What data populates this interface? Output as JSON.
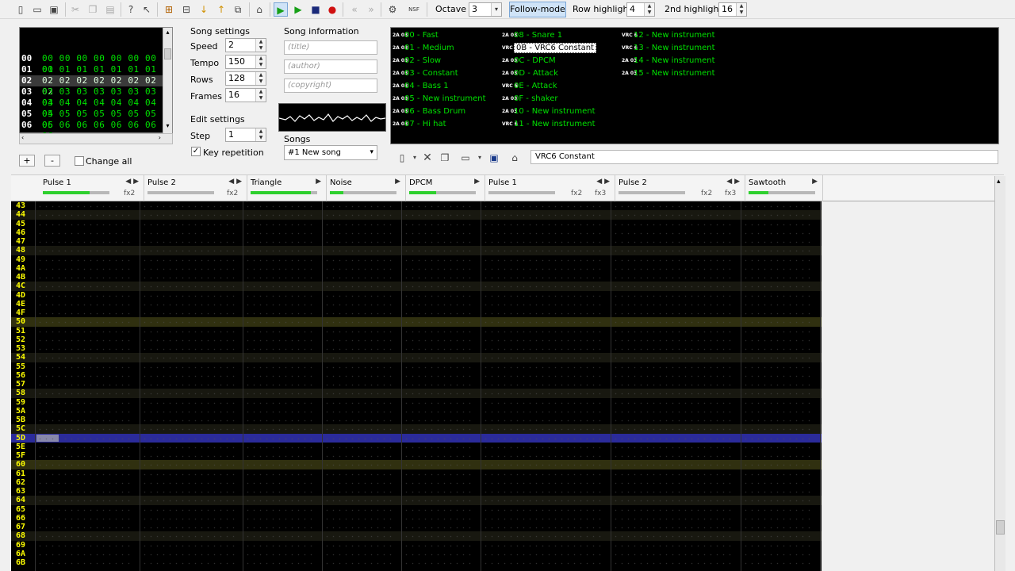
{
  "toolbar": {
    "octave_label": "Octave",
    "octave_value": "3",
    "follow_label": "Follow-mode",
    "row_highlight_label": "Row highlight",
    "row_highlight_value": "4",
    "second_highlight_label": "2nd highlight",
    "second_highlight_value": "16",
    "nsf_label": "NSF"
  },
  "frames": {
    "rows": [
      {
        "n": "00",
        "d": "00 00 00 00 00 00 00 00"
      },
      {
        "n": "01",
        "d": "01 01 01 01 01 01 01 01"
      },
      {
        "n": "02",
        "d": "02 02 02 02 02 02 02 02"
      },
      {
        "n": "03",
        "d": "03 03 03 03 03 03 03 03"
      },
      {
        "n": "04",
        "d": "04 04 04 04 04 04 04 04"
      },
      {
        "n": "05",
        "d": "05 05 05 05 05 05 05 05"
      },
      {
        "n": "06",
        "d": "06 06 06 06 06 06 06 06"
      }
    ],
    "add_label": "+",
    "remove_label": "-",
    "change_all_label": "Change all"
  },
  "song_settings": {
    "title": "Song settings",
    "speed_label": "Speed",
    "speed": "2",
    "tempo_label": "Tempo",
    "tempo": "150",
    "rows_label": "Rows",
    "rows": "128",
    "frames_label": "Frames",
    "frames": "16"
  },
  "edit_settings": {
    "title": "Edit settings",
    "step_label": "Step",
    "step": "1",
    "key_repetition_label": "Key repetition"
  },
  "song_info": {
    "title": "Song information",
    "title_placeholder": "(title)",
    "author_placeholder": "(author)",
    "copyright_placeholder": "(copyright)"
  },
  "songs": {
    "label": "Songs",
    "selected": "#1 New song"
  },
  "instruments": [
    {
      "icon": "2A 03",
      "name": "00 - Fast"
    },
    {
      "icon": "2A 03",
      "name": "01 - Medium"
    },
    {
      "icon": "2A 03",
      "name": "02 - Slow"
    },
    {
      "icon": "2A 03",
      "name": "03 - Constant"
    },
    {
      "icon": "2A 03",
      "name": "04 - Bass 1"
    },
    {
      "icon": "2A 03",
      "name": "05 - New instrument"
    },
    {
      "icon": "2A 03",
      "name": "06 - Bass Drum"
    },
    {
      "icon": "2A 03",
      "name": "07 - Hi hat"
    },
    {
      "icon": "2A 03",
      "name": "08 - Snare 1"
    },
    {
      "icon": "VRC 6",
      "name": "0B - VRC6 Constant"
    },
    {
      "icon": "2A 03",
      "name": "0C - DPCM"
    },
    {
      "icon": "2A 03",
      "name": "0D - Attack"
    },
    {
      "icon": "VRC 6",
      "name": "0E - Attack"
    },
    {
      "icon": "2A 03",
      "name": "0F - shaker"
    },
    {
      "icon": "2A 03",
      "name": "10 - New instrument"
    },
    {
      "icon": "VRC 6",
      "name": "11 - New instrument"
    },
    {
      "icon": "VRC 6",
      "name": "12 - New instrument"
    },
    {
      "icon": "VRC 6",
      "name": "13 - New instrument"
    },
    {
      "icon": "2A 03",
      "name": "14 - New instrument"
    },
    {
      "icon": "2A 03",
      "name": "15 - New instrument"
    }
  ],
  "instrument_name": "VRC6 Constant",
  "channels": [
    {
      "name": "Pulse 1",
      "fx": [
        "fx2"
      ],
      "level": 0.7
    },
    {
      "name": "Pulse 2",
      "fx": [
        "fx2"
      ],
      "level": 0.0
    },
    {
      "name": "Triangle",
      "fx": [],
      "level": 0.9
    },
    {
      "name": "Noise",
      "fx": [],
      "level": 0.2
    },
    {
      "name": "DPCM",
      "fx": [],
      "level": 0.4
    },
    {
      "name": "Pulse 1",
      "fx": [
        "fx2",
        "fx3"
      ],
      "level": 0.0
    },
    {
      "name": "Pulse 2",
      "fx": [
        "fx2",
        "fx3"
      ],
      "level": 0.0
    },
    {
      "name": "Sawtooth",
      "fx": [],
      "level": 0.3
    }
  ],
  "row_numbers": [
    "43",
    "44",
    "45",
    "46",
    "47",
    "48",
    "49",
    "4A",
    "4B",
    "4C",
    "4D",
    "4E",
    "4F",
    "50",
    "51",
    "52",
    "53",
    "54",
    "55",
    "56",
    "57",
    "58",
    "59",
    "5A",
    "5B",
    "5C",
    "5D",
    "5E",
    "5F",
    "60",
    "61",
    "62",
    "63",
    "64",
    "65",
    "66",
    "67",
    "68",
    "69",
    "6A",
    "6B"
  ],
  "colors": {
    "accent_green": "#00e000",
    "row_number": "#ffff00",
    "cursor_row": "#2b2b9a",
    "effect": "#ff8080"
  }
}
